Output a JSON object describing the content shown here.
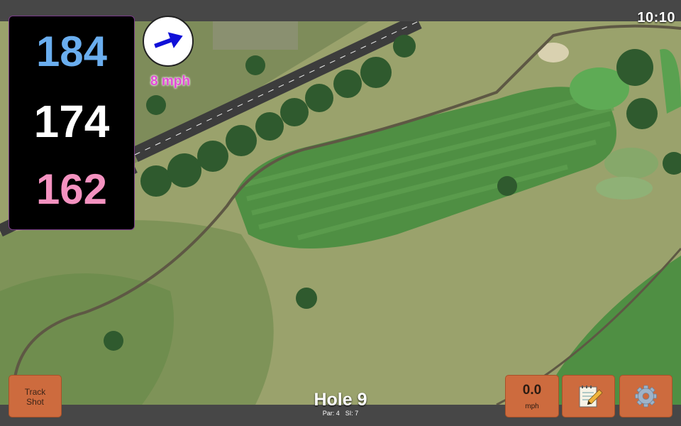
{
  "status": {
    "time": "10:10"
  },
  "distances": {
    "back": "184",
    "middle": "174",
    "front": "162"
  },
  "wind": {
    "speed_text": "8 mph",
    "direction_icon": "arrow-icon"
  },
  "hole": {
    "title": "Hole 9",
    "par": "Par: 4",
    "stroke_index": "SI: 7"
  },
  "buttons": {
    "track_shot_line1": "Track",
    "track_shot_line2": "Shot",
    "wind_value": "0.0",
    "wind_unit": "mph",
    "notes_icon": "notepad-icon",
    "settings_icon": "gear-icon"
  },
  "colors": {
    "back": "#6aaeef",
    "middle": "#ffffff",
    "front": "#f492c0",
    "button": "#cd6b3e",
    "wind_text": "#e24cd6"
  }
}
